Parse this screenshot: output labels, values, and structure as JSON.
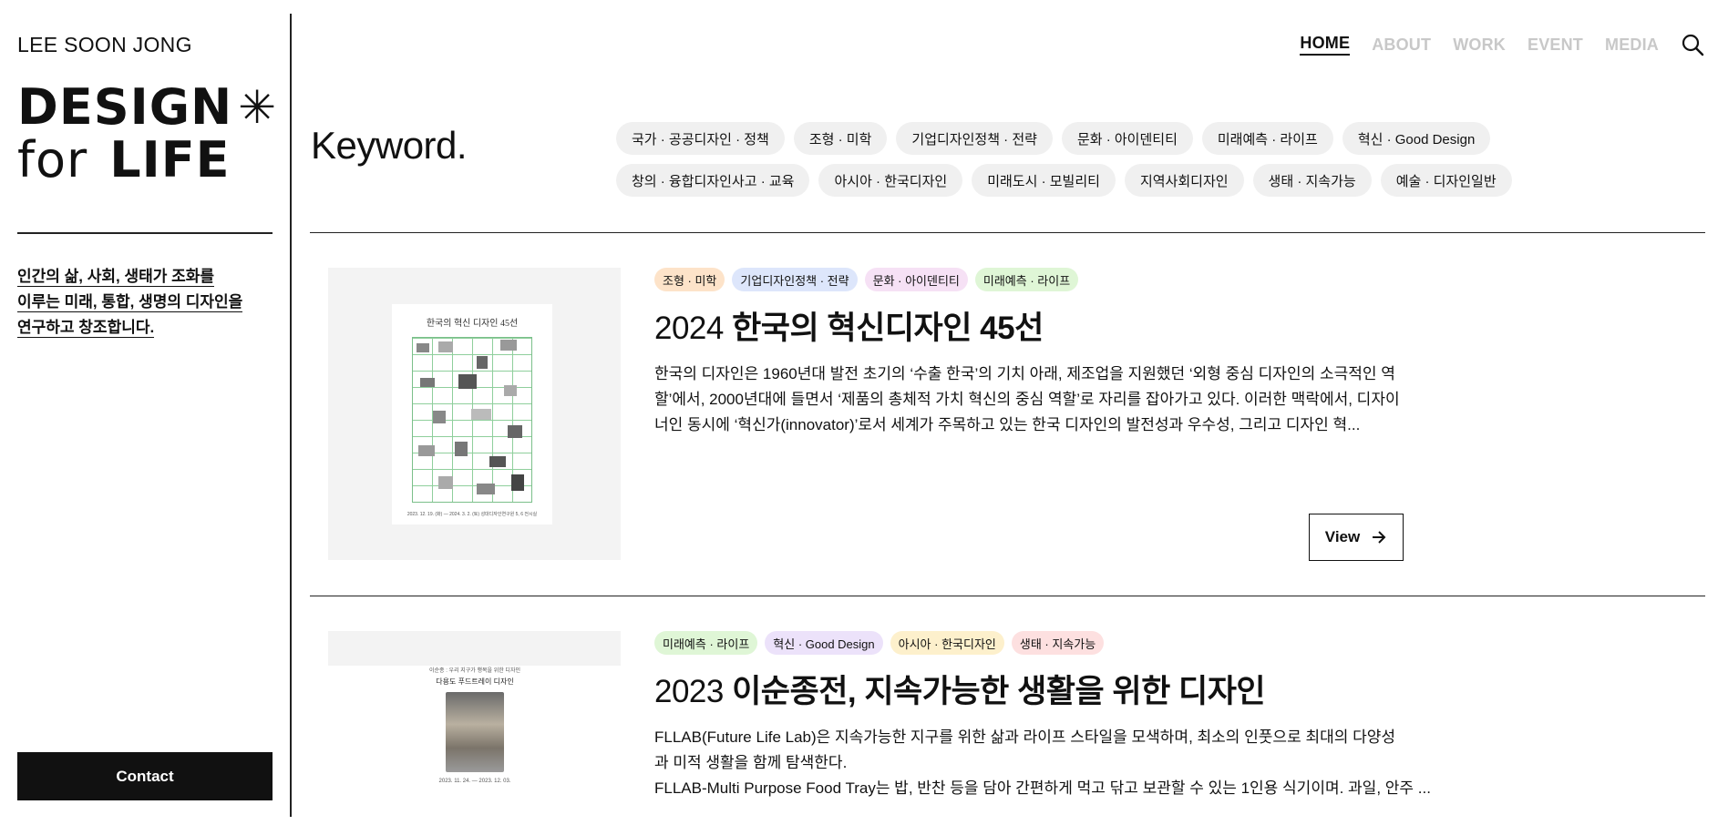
{
  "sidebar": {
    "author": "LEE SOON JONG",
    "logo": {
      "line1": "DESIGN",
      "star": "✳",
      "for": "for",
      "life": "LIFE"
    },
    "tagline_lines": [
      "인간의 삶, 사회, 생태가 조화를",
      "이루는 미래, 통합, 생명의 디자인을",
      "연구하고 창조합니다."
    ],
    "contact_label": "Contact"
  },
  "nav": {
    "items": [
      "HOME",
      "ABOUT",
      "WORK",
      "EVENT",
      "MEDIA"
    ],
    "active": "HOME",
    "search_icon": "search-icon"
  },
  "keywords": {
    "title": "Keyword.",
    "chips": [
      "국가 · 공공디자인 · 정책",
      "조형 · 미학",
      "기업디자인정책 · 전략",
      "문화 · 아이덴티티",
      "미래예측 · 라이프",
      "혁신 · Good Design",
      "창의 · 융합디자인사고 · 교육",
      "아시아 · 한국디자인",
      "미래도시 · 모빌리티",
      "지역사회디자인",
      "생태 · 지속가능",
      "예술 · 디자인일반"
    ]
  },
  "articles": [
    {
      "tags": [
        {
          "label": "조형 · 미학",
          "color": "#fde3c9"
        },
        {
          "label": "기업디자인정책 · 전략",
          "color": "#dde6fb"
        },
        {
          "label": "문화 · 아이덴티티",
          "color": "#f6e1f5"
        },
        {
          "label": "미래예측 · 라이프",
          "color": "#dff6d6"
        }
      ],
      "year": "2024",
      "title": "한국의 혁신디자인 45선",
      "desc": "한국의 디자인은 1960년대 발전 초기의 ‘수출 한국’의 기치 아래, 제조업을 지원했던 ‘외형 중심 디자인의 소극적인 역할’에서, 2000년대에 들면서 ‘제품의 총체적 가치 혁신의 중심 역할’로 자리를 잡아가고 있다. 이러한 맥락에서, 디자이너인 동시에 ‘혁신가(innovator)’로서 세계가 주목하고 있는 한국 디자인의 발전성과 우수성, 그리고 디자인 혁...",
      "poster_title": "한국의 혁신 디자인 45선",
      "poster_foot": "2023. 12. 19. (화) — 2024. 3. 2. (토)   성대디자인연구원 5, 6 전시실",
      "view_label": "View"
    },
    {
      "tags": [
        {
          "label": "미래예측 · 라이프",
          "color": "#dff6d6"
        },
        {
          "label": "혁신 · Good Design",
          "color": "#ece2fa"
        },
        {
          "label": "아시아 · 한국디자인",
          "color": "#fdf0cc"
        },
        {
          "label": "생태 · 지속가능",
          "color": "#fde0e0"
        }
      ],
      "year": "2023",
      "title": "이순종전, 지속가능한 생활을 위한 디자인",
      "desc_lines": [
        "FLLAB(Future Life Lab)은 지속가능한 지구를 위한 삶과 라이프 스타일을 모색하며, 최소의 인풋으로 최대의 다양성과 미적 생활을 함께 탐색한다.",
        "FLLAB-Multi Purpose Food Tray는 밥, 반찬 등을 담아 간편하게 먹고 닦고 보관할 수 있는 1인용 식기이며. 과일, 안주 ..."
      ],
      "poster_lines": [
        "이순종 : 우리 지구가 행복을 위한 디자인",
        "다용도 푸드트레이 디자인"
      ],
      "poster_dates": "2023. 11. 24. — 2023. 12. 03."
    }
  ]
}
